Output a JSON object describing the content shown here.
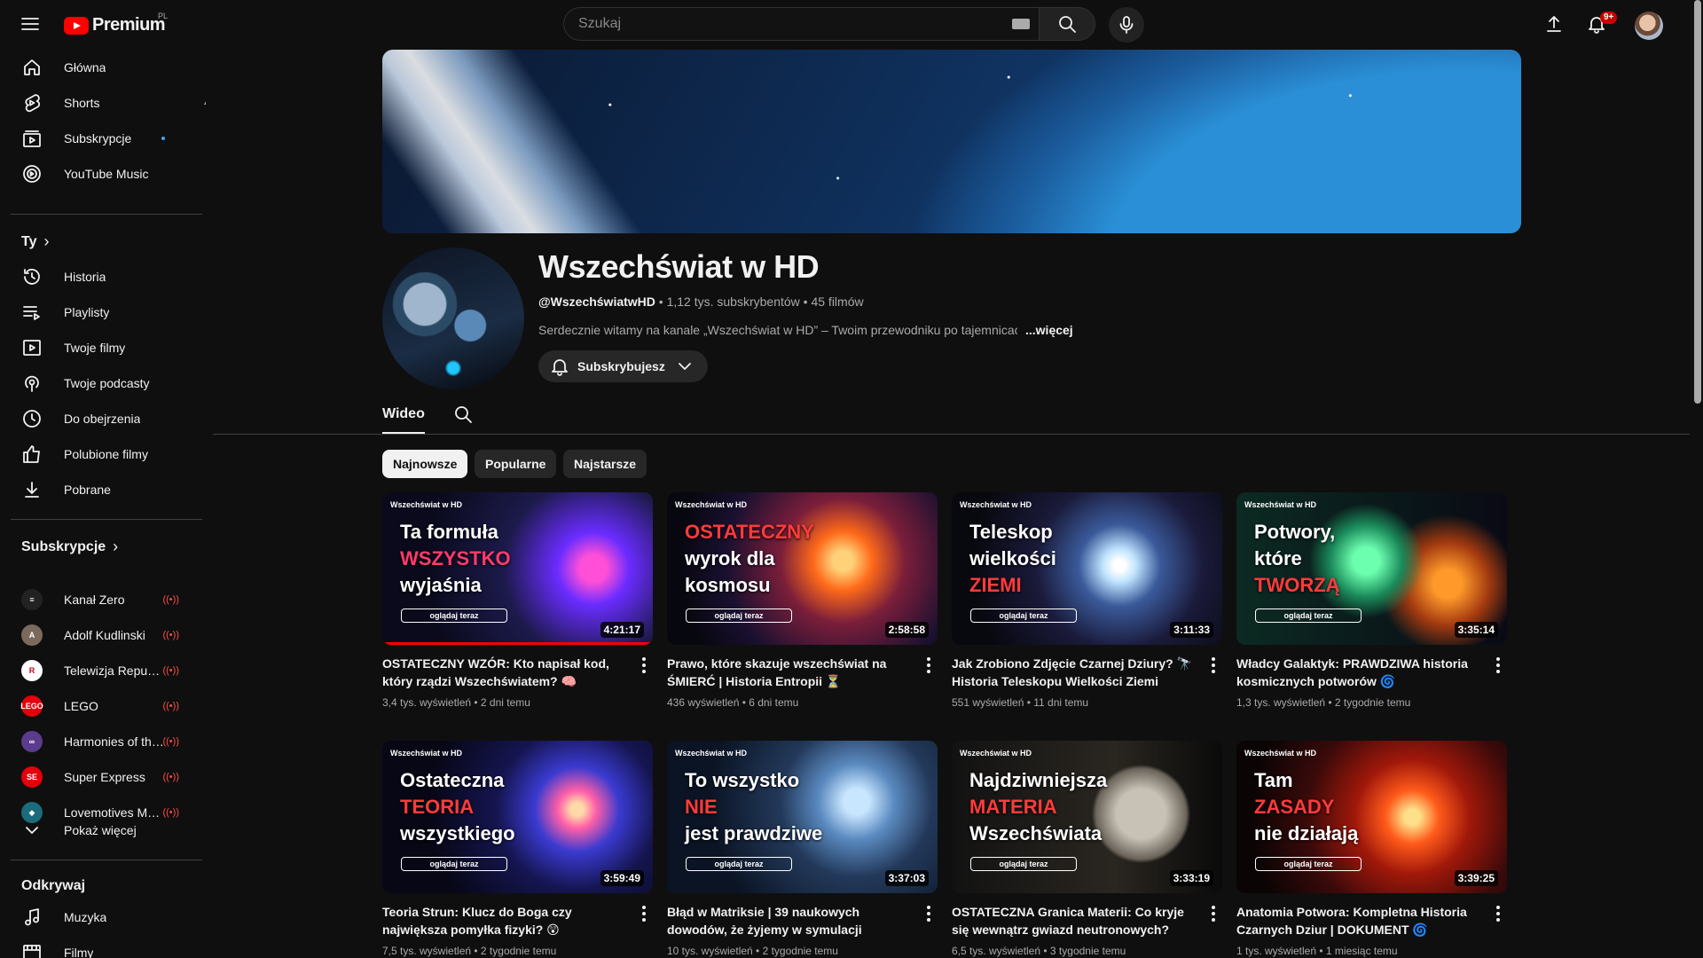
{
  "topbar": {
    "logo_text": "Premium",
    "country": "PL",
    "search_placeholder": "Szukaj",
    "notification_badge": "9+"
  },
  "sidebar": {
    "main": [
      {
        "label": "Główna",
        "icon": "home-icon"
      },
      {
        "label": "Shorts",
        "icon": "shorts-icon"
      },
      {
        "label": "Subskrypcje",
        "icon": "subscriptions-icon"
      },
      {
        "label": "YouTube Music",
        "icon": "music-icon"
      }
    ],
    "you_header": "Ty",
    "you": [
      {
        "label": "Historia",
        "icon": "history-icon"
      },
      {
        "label": "Playlisty",
        "icon": "playlists-icon"
      },
      {
        "label": "Twoje filmy",
        "icon": "your-videos-icon"
      },
      {
        "label": "Twoje podcasty",
        "icon": "podcast-icon"
      },
      {
        "label": "Do obejrzenia",
        "icon": "watch-later-icon"
      },
      {
        "label": "Polubione filmy",
        "icon": "like-icon"
      },
      {
        "label": "Pobrane",
        "icon": "download-icon"
      }
    ],
    "subs_header": "Subskrypcje",
    "subscriptions": [
      {
        "label": "Kanał Zero",
        "color": "#222222",
        "glyph": "≡"
      },
      {
        "label": "Adolf Kudlinski",
        "color": "#7b6a5c",
        "glyph": "A"
      },
      {
        "label": "Telewizja Republika",
        "color": "#ffffff",
        "glyph": "R"
      },
      {
        "label": "LEGO",
        "color": "#e3000b",
        "glyph": "LEGO"
      },
      {
        "label": "Harmonies of the Universe",
        "color": "#5b3b8c",
        "glyph": "∞"
      },
      {
        "label": "Super Express",
        "color": "#e3000b",
        "glyph": "SE"
      },
      {
        "label": "Lovemotives Media",
        "color": "#1b6b7a",
        "glyph": "◆"
      }
    ],
    "show_more": "Pokaż więcej",
    "explore_header": "Odkrywaj",
    "explore": [
      {
        "label": "Muzyka",
        "icon": "music-note-icon"
      },
      {
        "label": "Filmy",
        "icon": "film-icon"
      }
    ]
  },
  "channel": {
    "name": "Wszechświat w HD",
    "handle": "@WszechświatwHD",
    "subscribers": "1,12 tys. subskrybentów",
    "videos_count": "45 filmów",
    "description": "Serdecznie witamy na kanale „Wszechświat w HD” – Twoim przewodniku po tajemnicach",
    "more": "...więcej",
    "subscribe_label": "Subskrybujesz"
  },
  "tabs": {
    "videos": "Wideo"
  },
  "chips": [
    "Najnowsze",
    "Popularne",
    "Najstarsze"
  ],
  "videos": [
    {
      "thumb_lines": [
        "Ta formuła",
        "WSZYSTKO",
        "wyjaśnia"
      ],
      "accent_line": 1,
      "accent": "#ff3b6b",
      "bg": "radial-gradient(circle at 78% 50%, #ff4fd8 0 6%, #6a2cff 16%, #1c1a4a 40%, #0a0a1c 75%)",
      "duration": "4:21:17",
      "progress": 1.0,
      "title": "OSTATECZNY WZÓR: Kto napisał kod, który rządzi Wszechświatem? 🧠",
      "views": "3,4 tys. wyświetleń",
      "age": "2 dni temu"
    },
    {
      "thumb_lines": [
        "OSTATECZNY",
        "wyrok dla",
        "kosmosu"
      ],
      "accent_line": 0,
      "accent": "#ff3b3b",
      "bg": "radial-gradient(circle at 65% 45%, #ffd27a 0 5%, #ff6a1a 15%, #7a1e3a 32%, #1a1030 60%, #07070f 85%)",
      "duration": "2:58:58",
      "progress": 0,
      "title": "Prawo, które skazuje wszechświat na ŚMIERĆ | Historia Entropii ⏳",
      "views": "436 wyświetleń",
      "age": "6 dni temu"
    },
    {
      "thumb_lines": [
        "Teleskop",
        "wielkości",
        "ZIEMI"
      ],
      "accent_line": 2,
      "accent": "#ff3b3b",
      "bg": "radial-gradient(circle at 62% 48%, #ffffff 0 3%, #bfe3ff 9%, #3a5a9a 22%, #1a1a3a 45%, #08080f 80%)",
      "duration": "3:11:33",
      "progress": 0,
      "title": "Jak Zrobiono Zdjęcie Czarnej Dziury? 🔭 Historia Teleskopu Wielkości Ziemi",
      "views": "551 wyświetleń",
      "age": "11 dni temu"
    },
    {
      "thumb_lines": [
        "Potwory,",
        "które",
        "TWORZĄ"
      ],
      "accent_line": 2,
      "accent": "#ff3b3b",
      "bg": "radial-gradient(circle at 48% 45%, #6dffb0 0 8%, #1a8a5a 22%, transparent 35%), radial-gradient(circle at 78% 60%, #ff9a2a 0 6%, #a33a10 18%, transparent 30%), linear-gradient(90deg, #0b2a22, #0a0a14)",
      "duration": "3:35:14",
      "progress": 0,
      "title": "Władcy Galaktyk: PRAWDZIWA historia kosmicznych potworów 🌀",
      "views": "1,3 tys. wyświetleń",
      "age": "2 tygodnie temu"
    },
    {
      "thumb_lines": [
        "Ostateczna",
        "TEORIA",
        "wszystkiego"
      ],
      "accent_line": 1,
      "accent": "#ff3b3b",
      "bg": "radial-gradient(circle at 72% 45%, #ffd9a8 0 3%, #ff5fa8 9%, #3a3ad0 20%, #151550 38%, #070716 70%)",
      "duration": "3:59:49",
      "progress": 0,
      "title": "Teoria Strun: Klucz do Boga czy największa pomyłka fizyki? 😲",
      "views": "7,5 tys. wyświetleń",
      "age": "2 tygodnie temu"
    },
    {
      "thumb_lines": [
        "To wszystko",
        "NIE",
        "jest prawdziwe"
      ],
      "accent_line": 1,
      "accent": "#ff3b3b",
      "bg": "radial-gradient(circle at 70% 40%, #c9e6ff 0 6%, #5a8ac0 18%, #23395a 36%, #0a1424 70%)",
      "duration": "3:37:03",
      "progress": 0,
      "title": "Błąd w Matriksie | 39 naukowych dowodów, że żyjemy w symulacji",
      "views": "10 tys. wyświetleń",
      "age": "2 tygodnie temu"
    },
    {
      "thumb_lines": [
        "Najdziwniejsza",
        "MATERIA",
        "Wszechświata"
      ],
      "accent_line": 1,
      "accent": "#ff3b3b",
      "bg": "radial-gradient(circle at 70% 48%, #c8c2b6 0 12%, #6a645a 22%, transparent 24%), linear-gradient(90deg, #121212 0%, #2a2620 60%, #0a0a0a 100%)",
      "duration": "3:33:19",
      "progress": 0,
      "title": "OSTATECZNA Granica Materii: Co kryje się wewnątrz gwiazd neutronowych?",
      "views": "6,5 tys. wyświetleń",
      "age": "3 tygodnie temu"
    },
    {
      "thumb_lines": [
        "Tam",
        "ZASADY",
        "nie działają"
      ],
      "accent_line": 1,
      "accent": "#ff3b3b",
      "bg": "radial-gradient(circle at 65% 50%, #ffe08a 0 4%, #ff5a1a 14%, #a0180a 30%, #3a0a0a 55%, #0a0404 85%)",
      "duration": "3:39:25",
      "progress": 0,
      "title": "Anatomia Potwora: Kompletna Historia Czarnych Dziur | DOKUMENT 🌀",
      "views": "1 tys. wyświetleń",
      "age": "1 miesiąc temu"
    }
  ],
  "thumb_brand": "Wszechświat w HD",
  "thumb_cta": "oglądaj teraz"
}
